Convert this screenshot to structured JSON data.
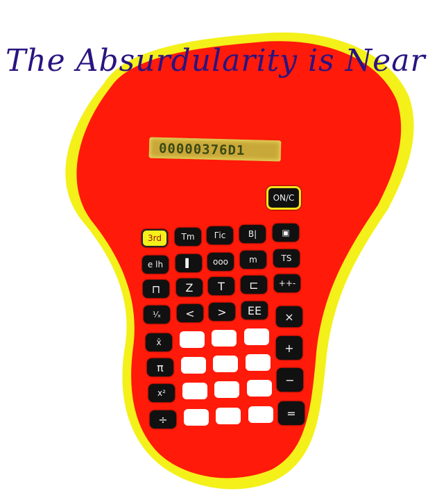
{
  "title": "The Absurdularity is Near",
  "colors": {
    "body": "#ff1a0a",
    "glow": "#f4f01a",
    "title": "#2a1480",
    "key": "#111111"
  },
  "display": {
    "reading": "00000376D1"
  },
  "keys": {
    "on": "ON/C",
    "third": "3rd",
    "r1c2": "Tm",
    "r1c3": "Γic",
    "r1c4": "B|",
    "r1c5": "▣",
    "r2c1": "e lh",
    "r2c2": "▌",
    "r2c3": "ooo",
    "r2c4": "m",
    "r2c5": "TS",
    "r3c1": "⊓",
    "r3c2": "Z",
    "r3c3": "T",
    "r3c4": "⊏",
    "r3c5": "++-",
    "r4c1": "¹⁄ₓ",
    "r4c2": "<",
    "r4c3": ">",
    "r4c4": "EE",
    "r4c5": "×",
    "side1": "x̄",
    "side2": "π",
    "side3": "x²",
    "side4": "÷",
    "plus": "+",
    "minus": "−",
    "equals": "="
  }
}
